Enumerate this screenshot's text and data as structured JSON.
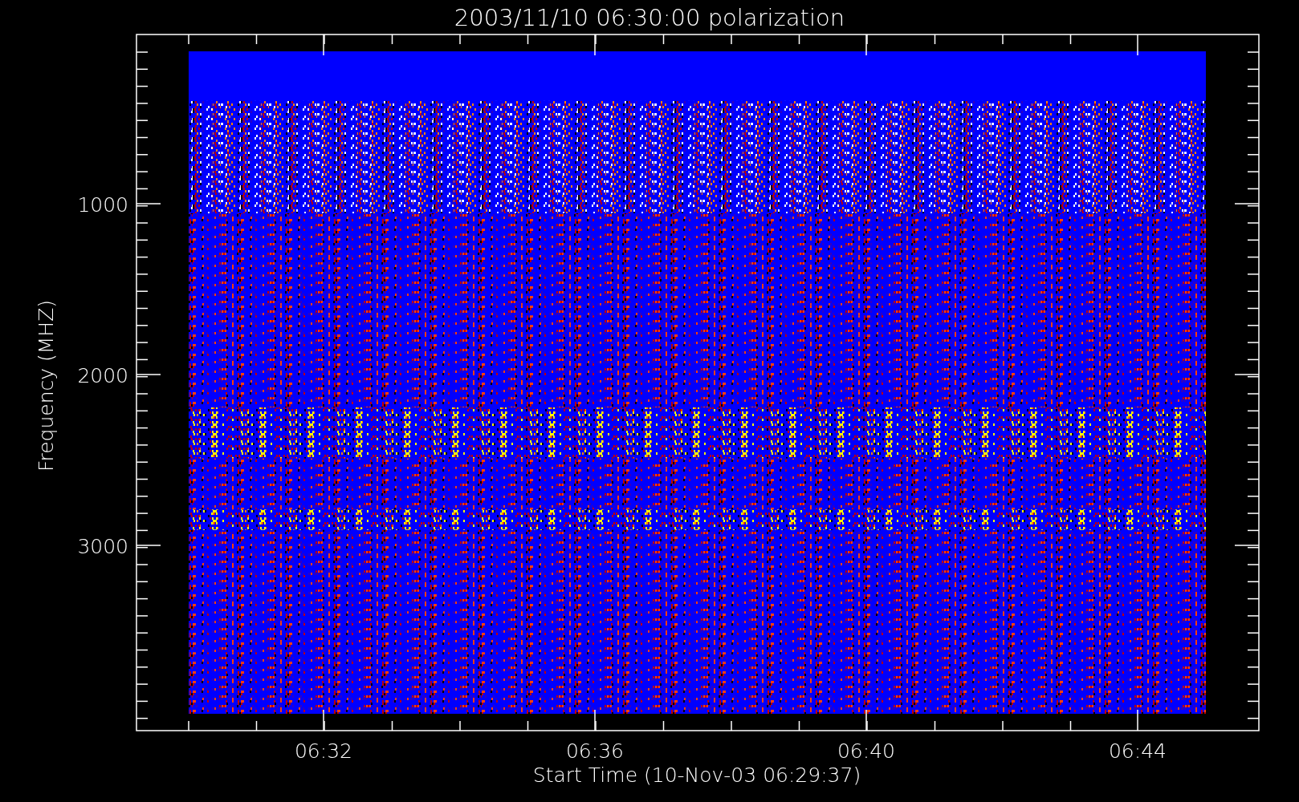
{
  "plot": {
    "title": "2003/11/10 06:30:00 polarization",
    "ylabel": "Frequency (MHZ)",
    "xlabel": "Start Time (10-Nov-03 06:29:37)",
    "yticks": [
      "1000",
      "2000",
      "3000"
    ],
    "xticks": [
      "06:32",
      "06:36",
      "06:40",
      "06:44"
    ]
  }
}
